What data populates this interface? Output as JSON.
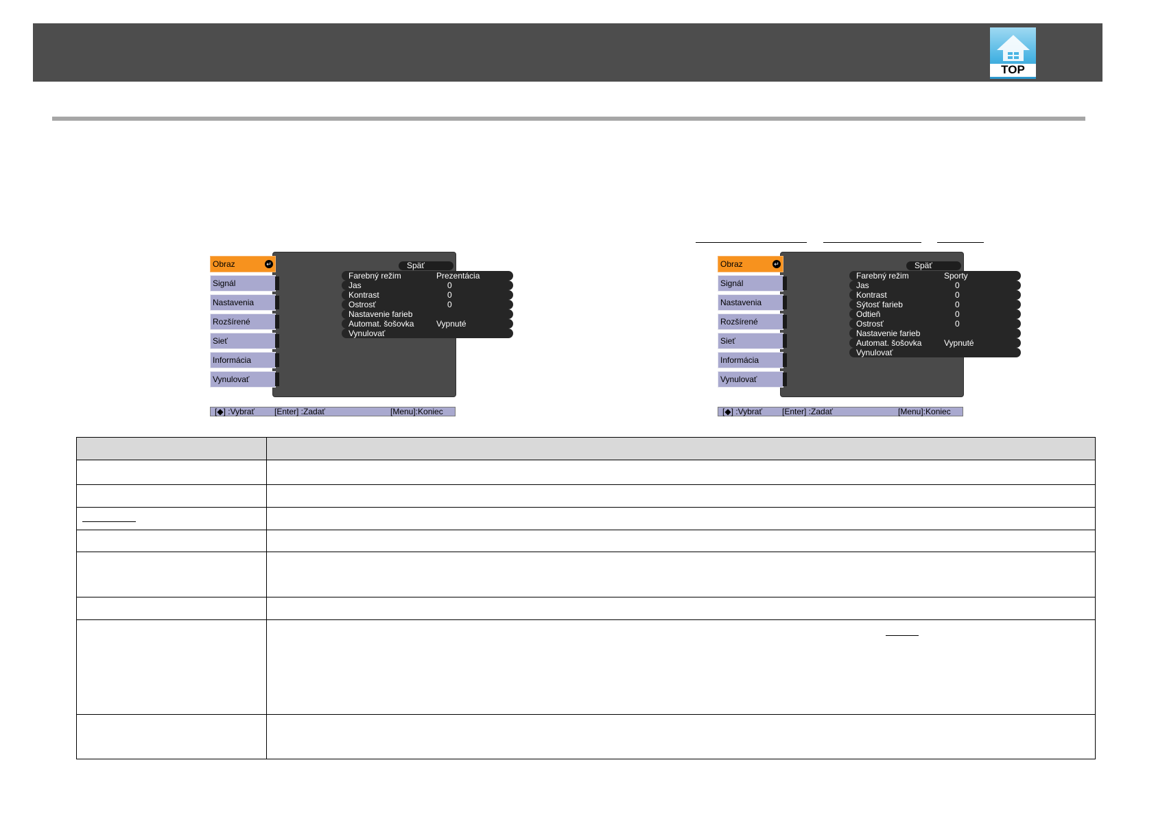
{
  "header": {
    "top_button_label": "TOP",
    "top_button_icon": "home-icon"
  },
  "menus": [
    {
      "sidebar": [
        "Obraz",
        "Signál",
        "Nastavenia",
        "Rozšírené",
        "Sieť",
        "Informácia",
        "Vynulovať"
      ],
      "back": "Späť",
      "rows": [
        {
          "label": "Farebný režim",
          "value": "Prezentácia"
        },
        {
          "label": "Jas",
          "value": "0"
        },
        {
          "label": "Kontrast",
          "value": "0"
        },
        {
          "label": "Ostrosť",
          "value": "0"
        },
        {
          "label": "Nastavenie farieb",
          "value": ""
        },
        {
          "label": "Automat. šošovka",
          "value": "Vypnuté"
        },
        {
          "label": "Vynulovať",
          "value": ""
        }
      ],
      "footer": {
        "select": "[◆] :Vybrať",
        "enter": "[Enter] :Zadať",
        "menu": "[Menu]:Koniec"
      }
    },
    {
      "sidebar": [
        "Obraz",
        "Signál",
        "Nastavenia",
        "Rozšírené",
        "Sieť",
        "Informácia",
        "Vynulovať"
      ],
      "back": "Späť",
      "rows": [
        {
          "label": "Farebný režim",
          "value": "Sporty"
        },
        {
          "label": "Jas",
          "value": "0"
        },
        {
          "label": "Kontrast",
          "value": "0"
        },
        {
          "label": "Sýtosť farieb",
          "value": "0"
        },
        {
          "label": "Odtieň",
          "value": "0"
        },
        {
          "label": "Ostrosť",
          "value": "0"
        },
        {
          "label": "Nastavenie farieb",
          "value": ""
        },
        {
          "label": "Automat. šošovka",
          "value": "Vypnuté"
        },
        {
          "label": "Vynulovať",
          "value": ""
        }
      ],
      "footer": {
        "select": "[◆] :Vybrať",
        "enter": "[Enter] :Zadať",
        "menu": "[Menu]:Koniec"
      }
    }
  ]
}
